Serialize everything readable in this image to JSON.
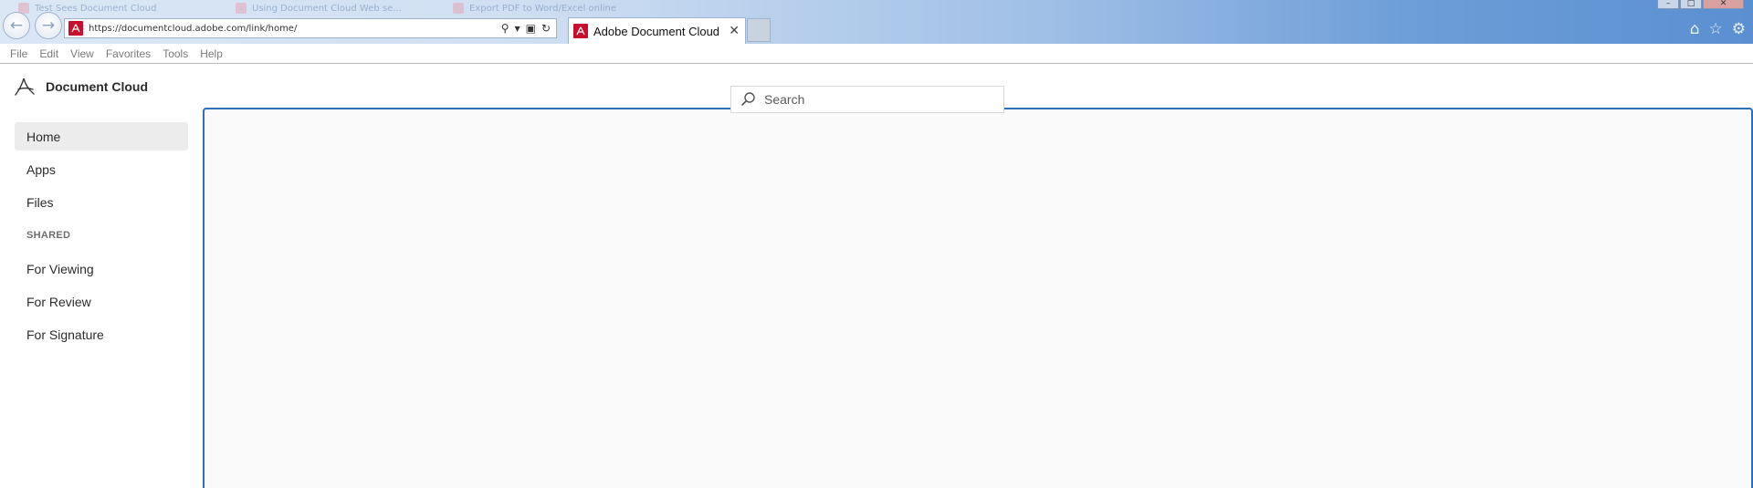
{
  "browser": {
    "background_tabs": [
      "Test Sees Document Cloud",
      "Using Document Cloud Web se...",
      "Export PDF to Word/Excel online"
    ],
    "address_url": "https://documentcloud.adobe.com/link/home/",
    "active_tab_title": "Adobe Document Cloud",
    "window_controls": [
      "minimize",
      "restore",
      "close"
    ],
    "toolbar_icons": [
      "home-icon",
      "star-icon",
      "gear-icon"
    ]
  },
  "menubar": [
    "File",
    "Edit",
    "View",
    "Favorites",
    "Tools",
    "Help"
  ],
  "app": {
    "brand_name": "Document Cloud",
    "search_placeholder": "Search",
    "nav": [
      {
        "label": "Home",
        "active": true
      },
      {
        "label": "Apps",
        "active": false
      },
      {
        "label": "Files",
        "active": false
      }
    ],
    "shared_header": "SHARED",
    "shared_nav": [
      {
        "label": "For Viewing"
      },
      {
        "label": "For Review"
      },
      {
        "label": "For Signature"
      }
    ]
  },
  "colors": {
    "accent_border": "#2d6fb6",
    "pdf_red": "#c8102e",
    "active_nav_bg": "#ececec"
  }
}
